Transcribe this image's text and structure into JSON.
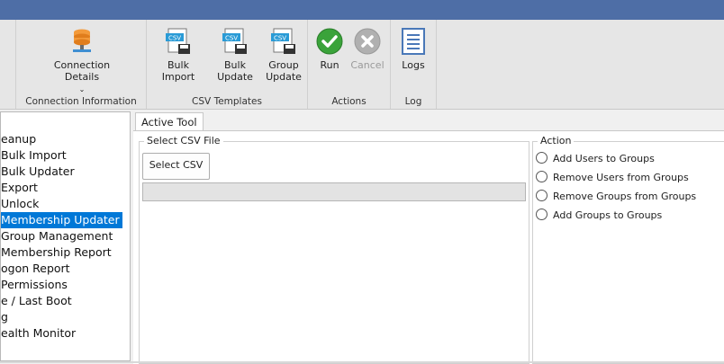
{
  "ribbon": {
    "groups": {
      "connection": {
        "label": "Connection Information",
        "connection_details": "Connection\nDetails",
        "caret": "⌄"
      },
      "csv": {
        "label": "CSV Templates",
        "bulk_import": "Bulk Import",
        "bulk_update": "Bulk Update",
        "group_update": "Group\nUpdate",
        "icon_text": "CSV"
      },
      "actions": {
        "label": "Actions",
        "run": "Run",
        "cancel": "Cancel"
      },
      "log": {
        "label": "Log",
        "logs": "Logs"
      }
    }
  },
  "sidebar": {
    "items": [
      {
        "label": "eanup"
      },
      {
        "label": "Bulk Import"
      },
      {
        "label": "Bulk Updater"
      },
      {
        "label": "Export"
      },
      {
        "label": "Unlock"
      },
      {
        "label": "Membership Updater",
        "selected": true
      },
      {
        "label": "Group Management"
      },
      {
        "label": "Membership Report"
      },
      {
        "label": "ogon Report"
      },
      {
        "label": "Permissions"
      },
      {
        "label": "e / Last Boot"
      },
      {
        "label": "g"
      },
      {
        "label": "ealth Monitor"
      }
    ]
  },
  "main": {
    "tab_label": "Active Tool",
    "csv_group": {
      "legend": "Select CSV File",
      "button": "Select CSV",
      "path_value": ""
    },
    "action_group": {
      "legend": "Action",
      "options": [
        "Add Users to Groups",
        "Remove Users from Groups",
        "Remove Groups from Groups",
        "Add Groups to Groups"
      ]
    }
  },
  "colors": {
    "titlebar": "#4e6ea6",
    "selection": "#0078d7",
    "run_green": "#3aa33a",
    "cancel_gray": "#b0b0b0"
  }
}
